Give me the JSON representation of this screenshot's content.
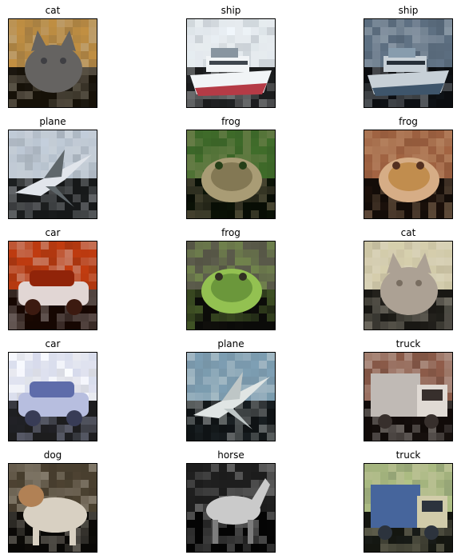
{
  "figure": {
    "background": "#ffffff",
    "images": [
      {
        "label": "cat",
        "colors": {
          "bg": "#b98a42",
          "mid": "#5a5e66",
          "dark": "#2f3544",
          "light": "#c9c3b8",
          "accent": "#2d5e9c"
        }
      },
      {
        "label": "ship",
        "colors": {
          "bg": "#e2e8ec",
          "mid": "#7d8a96",
          "dark": "#2a3038",
          "light": "#f4f6f7",
          "accent": "#b0242f"
        }
      },
      {
        "label": "ship",
        "colors": {
          "bg": "#5d6f80",
          "mid": "#8ea3b3",
          "dark": "#1f272e",
          "light": "#d7dee3",
          "accent": "#3b5368"
        }
      },
      {
        "label": "plane",
        "colors": {
          "bg": "#b9c3cf",
          "mid": "#545a5e",
          "dark": "#333636",
          "light": "#e7eaef",
          "accent": "#d03e4a"
        }
      },
      {
        "label": "frog",
        "colors": {
          "bg": "#3e6a2a",
          "mid": "#8c7a5a",
          "dark": "#233a16",
          "light": "#b8a380",
          "accent": "#6fa04a"
        }
      },
      {
        "label": "frog",
        "colors": {
          "bg": "#9c6040",
          "mid": "#c79350",
          "dark": "#4a2a1c",
          "light": "#dfb890",
          "accent": "#b23d3d"
        }
      },
      {
        "label": "car",
        "colors": {
          "bg": "#b83a10",
          "mid": "#8c2208",
          "dark": "#2c1610",
          "light": "#e8ecf0",
          "accent": "#e06a2a"
        }
      },
      {
        "label": "frog",
        "colors": {
          "bg": "#5a5a4a",
          "mid": "#6ea03a",
          "dark": "#2d2a1e",
          "light": "#9bd052",
          "accent": "#4f7a28"
        }
      },
      {
        "label": "cat",
        "colors": {
          "bg": "#cfc8a8",
          "mid": "#a89c92",
          "dark": "#6e6258",
          "light": "#ece6d4",
          "accent": "#c24a5a"
        }
      },
      {
        "label": "car",
        "colors": {
          "bg": "#eceef4",
          "mid": "#4a5aa0",
          "dark": "#1f2440",
          "light": "#b0b8dc",
          "accent": "#3a4a88"
        }
      },
      {
        "label": "plane",
        "colors": {
          "bg": "#7c9cb0",
          "mid": "#c8ccca",
          "dark": "#5a6a74",
          "light": "#eef0ec",
          "accent": "#a6b0b0"
        }
      },
      {
        "label": "truck",
        "colors": {
          "bg": "#8a5a48",
          "mid": "#c8c8c4",
          "dark": "#2c2a28",
          "light": "#ecece8",
          "accent": "#d36a2a"
        }
      },
      {
        "label": "dog",
        "colors": {
          "bg": "#4a4030",
          "mid": "#c08a5a",
          "dark": "#241e16",
          "light": "#ece4d6",
          "accent": "#6a7a3a"
        }
      },
      {
        "label": "horse",
        "colors": {
          "bg": "#1e1e1e",
          "mid": "#8a8a8a",
          "dark": "#0e0e0e",
          "light": "#e2e2e2",
          "accent": "#4a4a4a"
        }
      },
      {
        "label": "truck",
        "colors": {
          "bg": "#a8b880",
          "mid": "#3a5aa0",
          "dark": "#1c2234",
          "light": "#d8d0b0",
          "accent": "#e8c85a"
        }
      }
    ]
  }
}
